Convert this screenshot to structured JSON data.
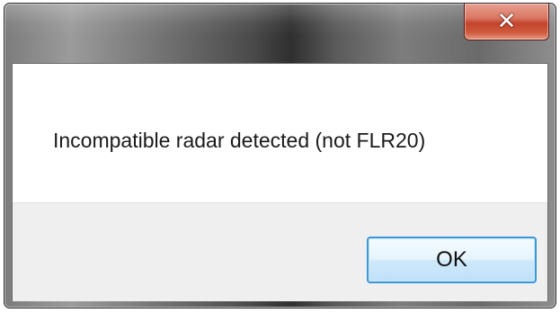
{
  "dialog": {
    "close_icon": "close-icon",
    "close_glyph": "✕",
    "message": "Incompatible radar detected (not FLR20)",
    "ok_label": "OK"
  },
  "colors": {
    "close_button": "#c4442c",
    "ok_border": "#3c97d6",
    "content_bg": "#ffffff",
    "button_area_bg": "#efefef"
  }
}
